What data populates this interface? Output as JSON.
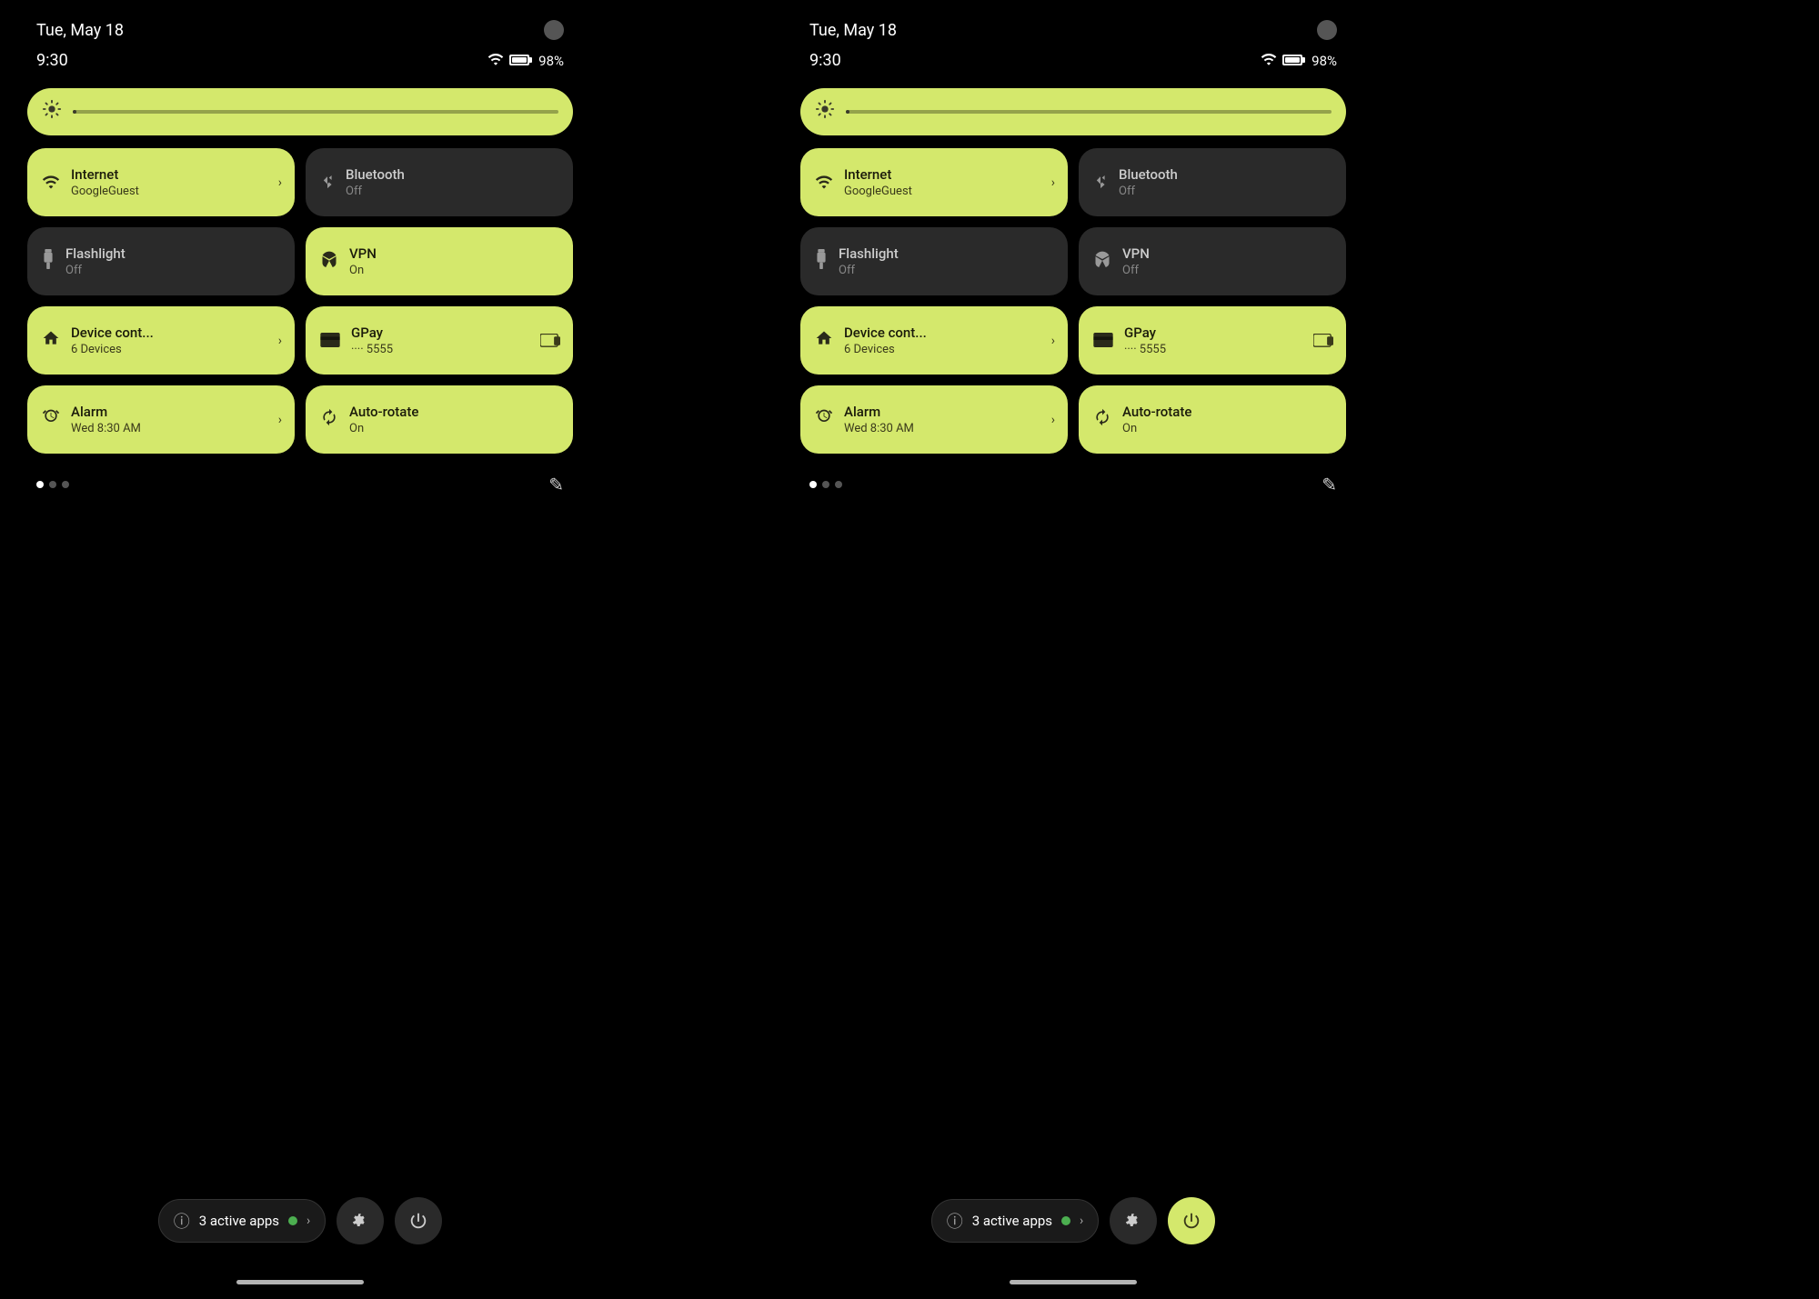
{
  "panels": [
    {
      "id": "left",
      "statusBar": {
        "date": "Tue, May 18",
        "time": "9:30",
        "battery": "98%"
      },
      "brightness": {
        "iconLabel": "⚙"
      },
      "tiles": [
        {
          "id": "internet",
          "label": "Internet",
          "sublabel": "GoogleGuest",
          "active": true,
          "hasChevron": true,
          "icon": "wifi"
        },
        {
          "id": "bluetooth",
          "label": "Bluetooth",
          "sublabel": "Off",
          "active": false,
          "hasChevron": false,
          "icon": "bluetooth"
        },
        {
          "id": "flashlight",
          "label": "Flashlight",
          "sublabel": "Off",
          "active": false,
          "hasChevron": false,
          "icon": "flashlight"
        },
        {
          "id": "vpn",
          "label": "VPN",
          "sublabel": "On",
          "active": true,
          "hasChevron": false,
          "icon": "vpn"
        },
        {
          "id": "device",
          "label": "Device cont...",
          "sublabel": "6 Devices",
          "active": true,
          "hasChevron": true,
          "icon": "home"
        },
        {
          "id": "gpay",
          "label": "GPay",
          "sublabel": "···· 5555",
          "active": true,
          "hasChevron": false,
          "hasCard": true,
          "icon": "card"
        },
        {
          "id": "alarm",
          "label": "Alarm",
          "sublabel": "Wed 8:30 AM",
          "active": true,
          "hasChevron": true,
          "icon": "alarm"
        },
        {
          "id": "autorotate",
          "label": "Auto-rotate",
          "sublabel": "On",
          "active": true,
          "hasChevron": false,
          "icon": "rotate"
        }
      ],
      "dots": [
        true,
        false,
        false
      ],
      "bottomBar": {
        "activeAppsLabel": "3 active apps",
        "settingsIcon": "⚙",
        "powerIcon": "⏻"
      }
    },
    {
      "id": "right",
      "statusBar": {
        "date": "Tue, May 18",
        "time": "9:30",
        "battery": "98%"
      },
      "brightness": {
        "iconLabel": "⚙"
      },
      "tiles": [
        {
          "id": "internet",
          "label": "Internet",
          "sublabel": "GoogleGuest",
          "active": true,
          "hasChevron": true,
          "icon": "wifi"
        },
        {
          "id": "bluetooth",
          "label": "Bluetooth",
          "sublabel": "Off",
          "active": false,
          "hasChevron": false,
          "icon": "bluetooth"
        },
        {
          "id": "flashlight",
          "label": "Flashlight",
          "sublabel": "Off",
          "active": false,
          "hasChevron": false,
          "icon": "flashlight"
        },
        {
          "id": "vpn",
          "label": "VPN",
          "sublabel": "Off",
          "active": false,
          "hasChevron": false,
          "icon": "vpn"
        },
        {
          "id": "device",
          "label": "Device cont...",
          "sublabel": "6 Devices",
          "active": true,
          "hasChevron": true,
          "icon": "home"
        },
        {
          "id": "gpay",
          "label": "GPay",
          "sublabel": "···· 5555",
          "active": true,
          "hasChevron": false,
          "hasCard": true,
          "icon": "card"
        },
        {
          "id": "alarm",
          "label": "Alarm",
          "sublabel": "Wed 8:30 AM",
          "active": true,
          "hasChevron": true,
          "icon": "alarm"
        },
        {
          "id": "autorotate",
          "label": "Auto-rotate",
          "sublabel": "On",
          "active": true,
          "hasChevron": false,
          "icon": "rotate"
        }
      ],
      "dots": [
        true,
        false,
        false
      ],
      "bottomBar": {
        "activeAppsLabel": "3 active apps",
        "settingsIcon": "⚙",
        "powerIcon": "⏻"
      }
    }
  ],
  "icons": {
    "wifi": "▲",
    "bluetooth": "✦",
    "flashlight": "⬛",
    "vpn": "◉",
    "home": "⌂",
    "card": "▬",
    "alarm": "◷",
    "rotate": "↻",
    "edit": "✎",
    "info": "ⓘ",
    "chevronRight": "›"
  },
  "colors": {
    "activetile": "#d4e86c",
    "inactivetile": "#2a2a2a",
    "accent": "#d4e86c"
  }
}
